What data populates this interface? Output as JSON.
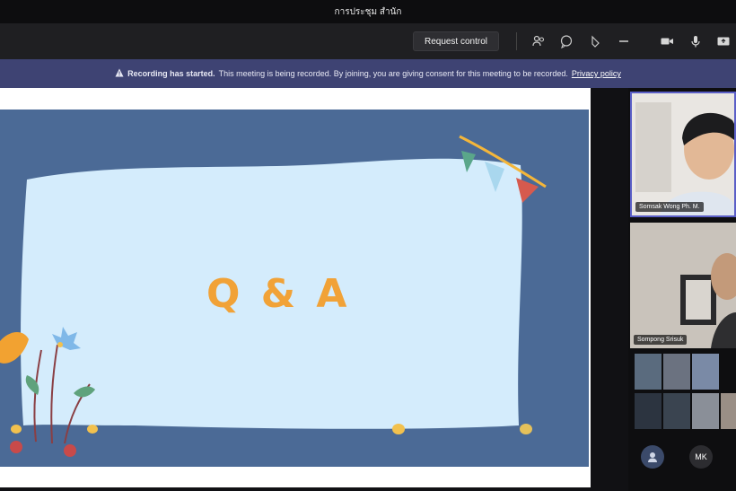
{
  "window": {
    "title": "การประชุม สำนัก"
  },
  "toolbar": {
    "request_control_label": "Request control",
    "icons": [
      "people-icon",
      "chat-icon",
      "reactions-icon",
      "more-icon",
      "camera-icon",
      "mic-icon",
      "share-icon"
    ]
  },
  "banner": {
    "title": "Recording has started.",
    "message": "This meeting is being recorded. By joining, you are giving consent for this meeting to be recorded.",
    "link": "Privacy policy"
  },
  "slide": {
    "heading": "Q & A"
  },
  "participants": {
    "tile1_name": "Somsak Wong Ph. M.",
    "tile2_name": "Sompong Srisuk",
    "badge_label": "MK"
  },
  "colors": {
    "accent": "#5b5fc7",
    "banner": "#3e4373",
    "slide_bg": "#4b6a96",
    "heading": "#f1a237"
  }
}
